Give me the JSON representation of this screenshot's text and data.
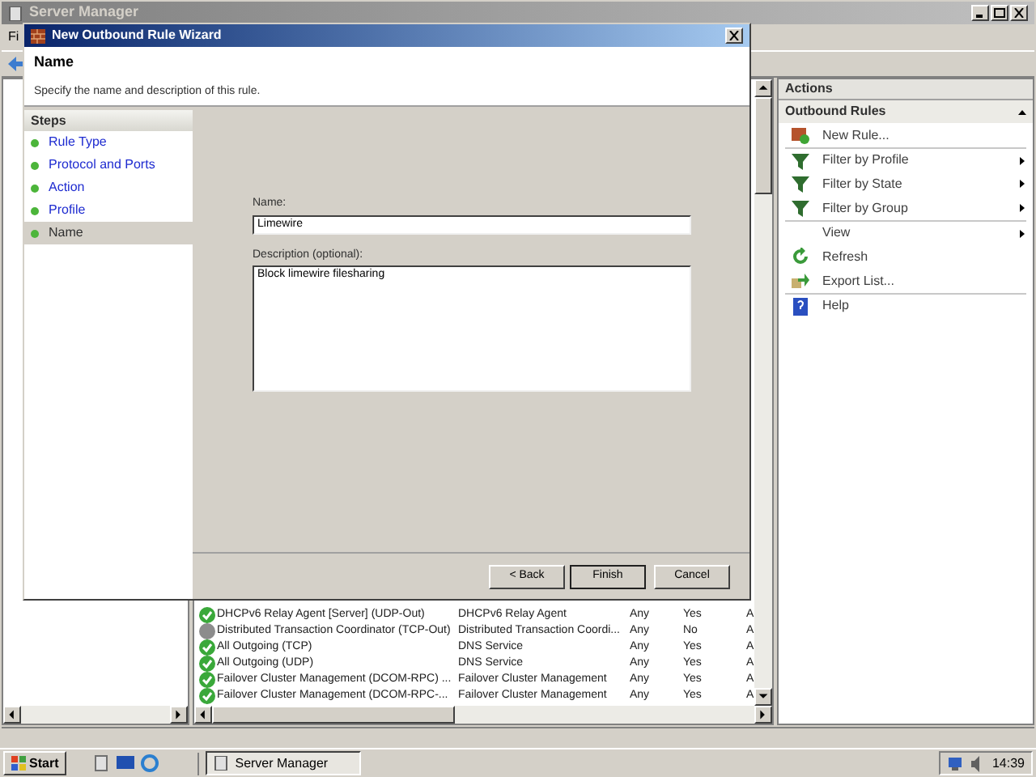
{
  "window": {
    "title": "Server Manager",
    "menu": [
      "Fi"
    ]
  },
  "wizard": {
    "title": "New Outbound Rule Wizard",
    "heading": "Name",
    "subtitle": "Specify the name and description of this rule.",
    "steps_title": "Steps",
    "steps": [
      {
        "label": "Rule Type",
        "selected": false
      },
      {
        "label": "Protocol and Ports",
        "selected": false
      },
      {
        "label": "Action",
        "selected": false
      },
      {
        "label": "Profile",
        "selected": false
      },
      {
        "label": "Name",
        "selected": true
      }
    ],
    "name_field": {
      "label": "Name:",
      "value": "Limewire"
    },
    "description_field": {
      "label": "Description (optional):",
      "value": "Block limewire filesharing"
    },
    "buttons": [
      "< Back",
      "Finish",
      "Cancel"
    ]
  },
  "rules": [
    {
      "name": "DHCPv6 Relay Agent [Server] (UDP-Out)",
      "group": "DHCPv6 Relay Agent",
      "profile": "Any",
      "enabled": true,
      "enabled_text": "Yes",
      "column_5": "A"
    },
    {
      "name": "Distributed Transaction Coordinator (TCP-Out)",
      "group": "Distributed Transaction Coordi...",
      "profile": "Any",
      "enabled": false,
      "enabled_text": "No",
      "column_5": "A"
    },
    {
      "name": "All Outgoing (TCP)",
      "group": "DNS Service",
      "profile": "Any",
      "enabled": true,
      "enabled_text": "Yes",
      "column_5": "A"
    },
    {
      "name": "All Outgoing (UDP)",
      "group": "DNS Service",
      "profile": "Any",
      "enabled": true,
      "enabled_text": "Yes",
      "column_5": "A"
    },
    {
      "name": "Failover Cluster Management (DCOM-RPC) ...",
      "group": "Failover Cluster Management",
      "profile": "Any",
      "enabled": true,
      "enabled_text": "Yes",
      "column_5": "A"
    },
    {
      "name": "Failover Cluster Management (DCOM-RPC-...",
      "group": "Failover Cluster Management",
      "profile": "Any",
      "enabled": true,
      "enabled_text": "Yes",
      "column_5": "A"
    }
  ],
  "actions": {
    "title": "Actions",
    "section": "Outbound Rules",
    "items": [
      {
        "label": "New Rule...",
        "kind": "new",
        "submenu": false,
        "group_start": false
      },
      {
        "label": "Filter by Profile",
        "kind": "filter",
        "submenu": true,
        "group_start": true
      },
      {
        "label": "Filter by State",
        "kind": "filter",
        "submenu": true,
        "group_start": false
      },
      {
        "label": "Filter by Group",
        "kind": "filter",
        "submenu": true,
        "group_start": false
      },
      {
        "label": "View",
        "kind": "view",
        "submenu": true,
        "group_start": true
      },
      {
        "label": "Refresh",
        "kind": "refresh",
        "submenu": false,
        "group_start": false
      },
      {
        "label": "Export List...",
        "kind": "export",
        "submenu": false,
        "group_start": false
      },
      {
        "label": "Help",
        "kind": "help",
        "submenu": false,
        "group_start": true
      }
    ]
  },
  "taskbar": {
    "start": "Start",
    "tasks": [
      "Server Manager"
    ],
    "clock": "14:39"
  }
}
